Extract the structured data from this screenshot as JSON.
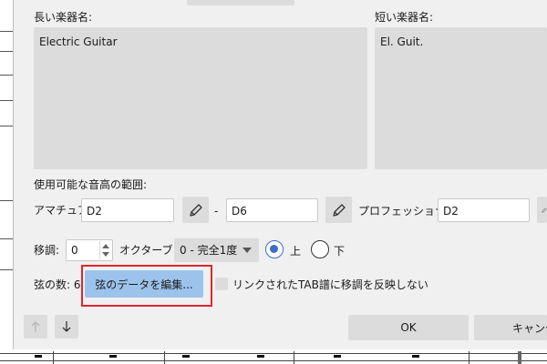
{
  "dialog": {
    "long_name_label": "長い楽器名:",
    "long_name_value": "Electric Guitar",
    "short_name_label": "短い楽器名:",
    "short_name_value": "El. Guit.",
    "range_label": "使用可能な音高の範囲:",
    "amateur_label": "アマチュア:",
    "amateur_low": "D2",
    "range_dash": "-",
    "amateur_high": "D6",
    "professional_label": "プロフェッショナル:",
    "professional_low": "D2",
    "transpose_label": "移調:",
    "transpose_value": "0",
    "octave_label": "オクターブ +",
    "interval_value": "0 - 完全1度",
    "up_label": "上",
    "down_label": "下",
    "strings_label": "弦の数: 6",
    "edit_strings_button": "弦のデータを編集...",
    "tab_checkbox_label": "リンクされたTAB譜に移調を反映しない",
    "ok_button": "OK",
    "cancel_button": "キャンセル"
  },
  "icons": {
    "pencil": "pencil-icon",
    "arrow_up": "arrow-up-icon",
    "arrow_down": "arrow-down-icon"
  },
  "colors": {
    "dialog_bg": "#f0f0f0",
    "field_bg": "#dcdcdc",
    "primary_button": "#9cc3ec",
    "highlight": "#e0262b",
    "radio_selected": "#3a6fc4"
  }
}
